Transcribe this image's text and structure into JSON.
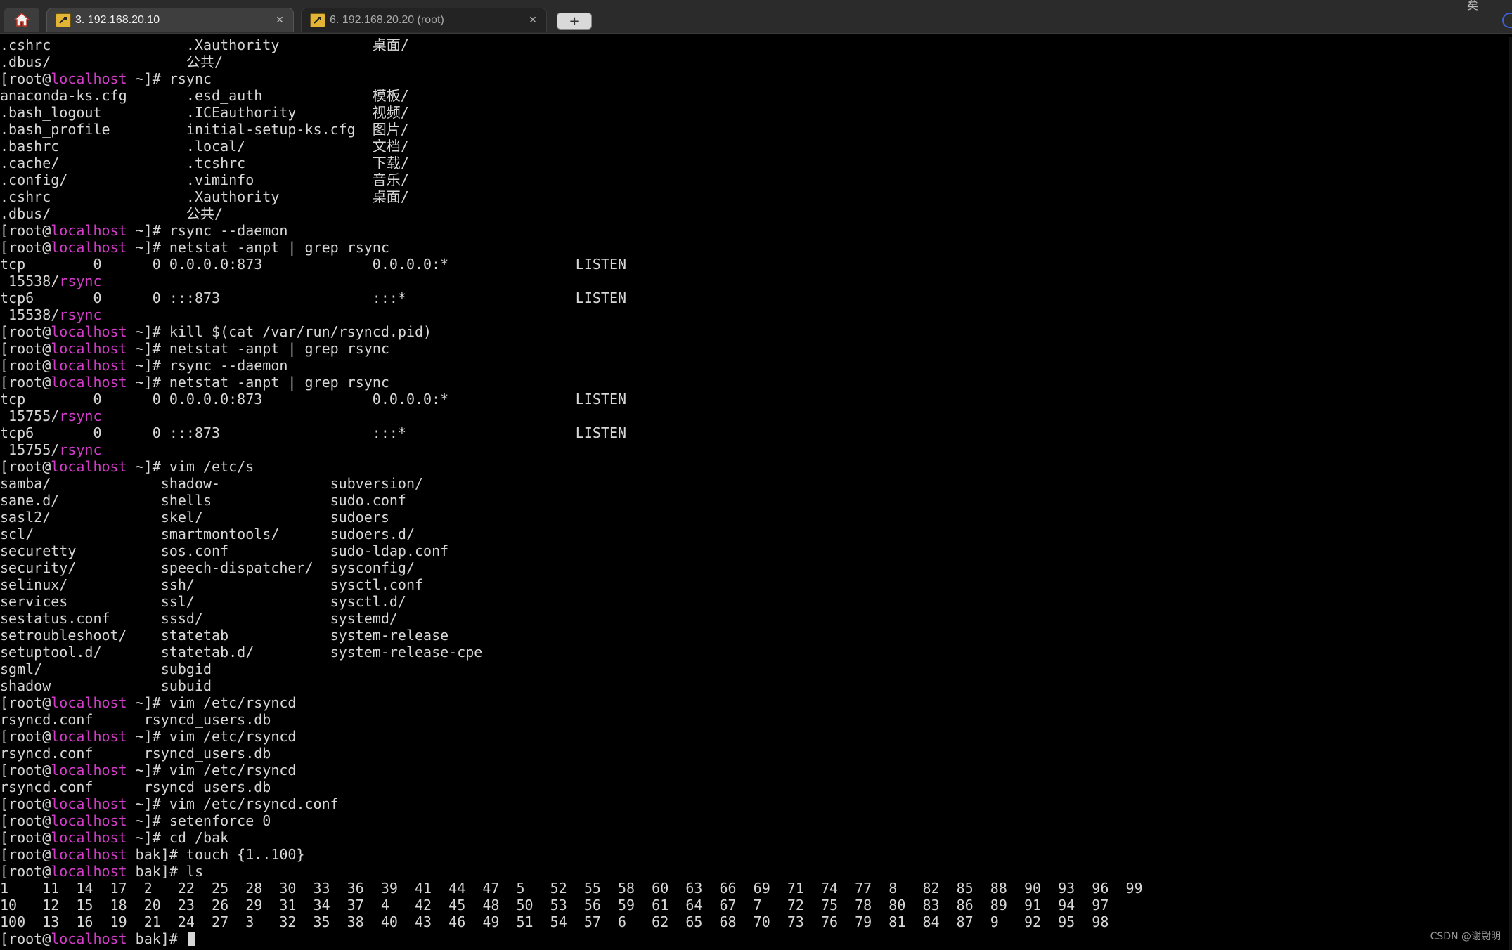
{
  "tabs": {
    "home_icon": "home-icon",
    "items": [
      {
        "title": "3. 192.168.20.10",
        "icon": "putty-terminal-icon",
        "close": "×",
        "active": true
      },
      {
        "title": "6. 192.168.20.20 (root)",
        "icon": "putty-terminal-icon",
        "close": "×",
        "active": false
      }
    ],
    "new_tab_label": "+",
    "corner_glyph": "矣"
  },
  "colors": {
    "background": "#000000",
    "text": "#d7d7d7",
    "hostname": "#d23cc8"
  },
  "terminal": {
    "lines": [
      {
        "segs": [
          {
            "t": ".cshrc                .Xauthority           桌面/"
          }
        ]
      },
      {
        "segs": [
          {
            "t": ".dbus/                公共/"
          }
        ]
      },
      {
        "segs": [
          {
            "t": "[root@"
          },
          {
            "t": "localhost",
            "c": "magenta"
          },
          {
            "t": " ~]# rsync"
          }
        ]
      },
      {
        "segs": [
          {
            "t": "anaconda-ks.cfg       .esd_auth             模板/"
          }
        ]
      },
      {
        "segs": [
          {
            "t": ".bash_logout          .ICEauthority         视频/"
          }
        ]
      },
      {
        "segs": [
          {
            "t": ".bash_profile         initial-setup-ks.cfg  图片/"
          }
        ]
      },
      {
        "segs": [
          {
            "t": ".bashrc               .local/               文档/"
          }
        ]
      },
      {
        "segs": [
          {
            "t": ".cache/               .tcshrc               下载/"
          }
        ]
      },
      {
        "segs": [
          {
            "t": ".config/              .viminfo              音乐/"
          }
        ]
      },
      {
        "segs": [
          {
            "t": ".cshrc                .Xauthority           桌面/"
          }
        ]
      },
      {
        "segs": [
          {
            "t": ".dbus/                公共/"
          }
        ]
      },
      {
        "segs": [
          {
            "t": "[root@"
          },
          {
            "t": "localhost",
            "c": "magenta"
          },
          {
            "t": " ~]# rsync --daemon"
          }
        ]
      },
      {
        "segs": [
          {
            "t": "[root@"
          },
          {
            "t": "localhost",
            "c": "magenta"
          },
          {
            "t": " ~]# netstat -anpt | grep rsync"
          }
        ]
      },
      {
        "segs": [
          {
            "t": "tcp        0      0 0.0.0.0:873             0.0.0.0:*               LISTEN"
          }
        ]
      },
      {
        "segs": [
          {
            "t": " 15538/"
          },
          {
            "t": "rsync",
            "c": "magenta"
          }
        ]
      },
      {
        "segs": [
          {
            "t": "tcp6       0      0 :::873                  :::*                    LISTEN"
          }
        ]
      },
      {
        "segs": [
          {
            "t": " 15538/"
          },
          {
            "t": "rsync",
            "c": "magenta"
          }
        ]
      },
      {
        "segs": [
          {
            "t": "[root@"
          },
          {
            "t": "localhost",
            "c": "magenta"
          },
          {
            "t": " ~]# kill $(cat /var/run/rsyncd.pid)"
          }
        ]
      },
      {
        "segs": [
          {
            "t": "[root@"
          },
          {
            "t": "localhost",
            "c": "magenta"
          },
          {
            "t": " ~]# netstat -anpt | grep rsync"
          }
        ]
      },
      {
        "segs": [
          {
            "t": "[root@"
          },
          {
            "t": "localhost",
            "c": "magenta"
          },
          {
            "t": " ~]# rsync --daemon"
          }
        ]
      },
      {
        "segs": [
          {
            "t": "[root@"
          },
          {
            "t": "localhost",
            "c": "magenta"
          },
          {
            "t": " ~]# netstat -anpt | grep rsync"
          }
        ]
      },
      {
        "segs": [
          {
            "t": "tcp        0      0 0.0.0.0:873             0.0.0.0:*               LISTEN"
          }
        ]
      },
      {
        "segs": [
          {
            "t": " 15755/"
          },
          {
            "t": "rsync",
            "c": "magenta"
          }
        ]
      },
      {
        "segs": [
          {
            "t": "tcp6       0      0 :::873                  :::*                    LISTEN"
          }
        ]
      },
      {
        "segs": [
          {
            "t": " 15755/"
          },
          {
            "t": "rsync",
            "c": "magenta"
          }
        ]
      },
      {
        "segs": [
          {
            "t": "[root@"
          },
          {
            "t": "localhost",
            "c": "magenta"
          },
          {
            "t": " ~]# vim /etc/s"
          }
        ]
      },
      {
        "segs": [
          {
            "t": "samba/             shadow-             subversion/"
          }
        ]
      },
      {
        "segs": [
          {
            "t": "sane.d/            shells              sudo.conf"
          }
        ]
      },
      {
        "segs": [
          {
            "t": "sasl2/             skel/               sudoers"
          }
        ]
      },
      {
        "segs": [
          {
            "t": "scl/               smartmontools/      sudoers.d/"
          }
        ]
      },
      {
        "segs": [
          {
            "t": "securetty          sos.conf            sudo-ldap.conf"
          }
        ]
      },
      {
        "segs": [
          {
            "t": "security/          speech-dispatcher/  sysconfig/"
          }
        ]
      },
      {
        "segs": [
          {
            "t": "selinux/           ssh/                sysctl.conf"
          }
        ]
      },
      {
        "segs": [
          {
            "t": "services           ssl/                sysctl.d/"
          }
        ]
      },
      {
        "segs": [
          {
            "t": "sestatus.conf      sssd/               systemd/"
          }
        ]
      },
      {
        "segs": [
          {
            "t": "setroubleshoot/    statetab            system-release"
          }
        ]
      },
      {
        "segs": [
          {
            "t": "setuptool.d/       statetab.d/         system-release-cpe"
          }
        ]
      },
      {
        "segs": [
          {
            "t": "sgml/              subgid"
          }
        ]
      },
      {
        "segs": [
          {
            "t": "shadow             subuid"
          }
        ]
      },
      {
        "segs": [
          {
            "t": "[root@"
          },
          {
            "t": "localhost",
            "c": "magenta"
          },
          {
            "t": " ~]# vim /etc/rsyncd"
          }
        ]
      },
      {
        "segs": [
          {
            "t": "rsyncd.conf      rsyncd_users.db"
          }
        ]
      },
      {
        "segs": [
          {
            "t": "[root@"
          },
          {
            "t": "localhost",
            "c": "magenta"
          },
          {
            "t": " ~]# vim /etc/rsyncd"
          }
        ]
      },
      {
        "segs": [
          {
            "t": "rsyncd.conf      rsyncd_users.db"
          }
        ]
      },
      {
        "segs": [
          {
            "t": "[root@"
          },
          {
            "t": "localhost",
            "c": "magenta"
          },
          {
            "t": " ~]# vim /etc/rsyncd"
          }
        ]
      },
      {
        "segs": [
          {
            "t": "rsyncd.conf      rsyncd_users.db"
          }
        ]
      },
      {
        "segs": [
          {
            "t": "[root@"
          },
          {
            "t": "localhost",
            "c": "magenta"
          },
          {
            "t": " ~]# vim /etc/rsyncd.conf"
          }
        ]
      },
      {
        "segs": [
          {
            "t": "[root@"
          },
          {
            "t": "localhost",
            "c": "magenta"
          },
          {
            "t": " ~]# setenforce 0"
          }
        ]
      },
      {
        "segs": [
          {
            "t": "[root@"
          },
          {
            "t": "localhost",
            "c": "magenta"
          },
          {
            "t": " ~]# cd /bak"
          }
        ]
      },
      {
        "segs": [
          {
            "t": "[root@"
          },
          {
            "t": "localhost",
            "c": "magenta"
          },
          {
            "t": " bak]# touch {1..100}"
          }
        ]
      },
      {
        "segs": [
          {
            "t": "[root@"
          },
          {
            "t": "localhost",
            "c": "magenta"
          },
          {
            "t": " bak]# ls"
          }
        ]
      },
      {
        "segs": [
          {
            "t": "1    11  14  17  2   22  25  28  30  33  36  39  41  44  47  5   52  55  58  60  63  66  69  71  74  77  8   82  85  88  90  93  96  99"
          }
        ]
      },
      {
        "segs": [
          {
            "t": "10   12  15  18  20  23  26  29  31  34  37  4   42  45  48  50  53  56  59  61  64  67  7   72  75  78  80  83  86  89  91  94  97"
          }
        ]
      },
      {
        "segs": [
          {
            "t": "100  13  16  19  21  24  27  3   32  35  38  40  43  46  49  51  54  57  6   62  65  68  70  73  76  79  81  84  87  9   92  95  98"
          }
        ]
      },
      {
        "segs": [
          {
            "t": "[root@"
          },
          {
            "t": "localhost",
            "c": "magenta"
          },
          {
            "t": " bak]# "
          }
        ],
        "cursor": true
      }
    ]
  },
  "watermark": "CSDN @谢尉明"
}
